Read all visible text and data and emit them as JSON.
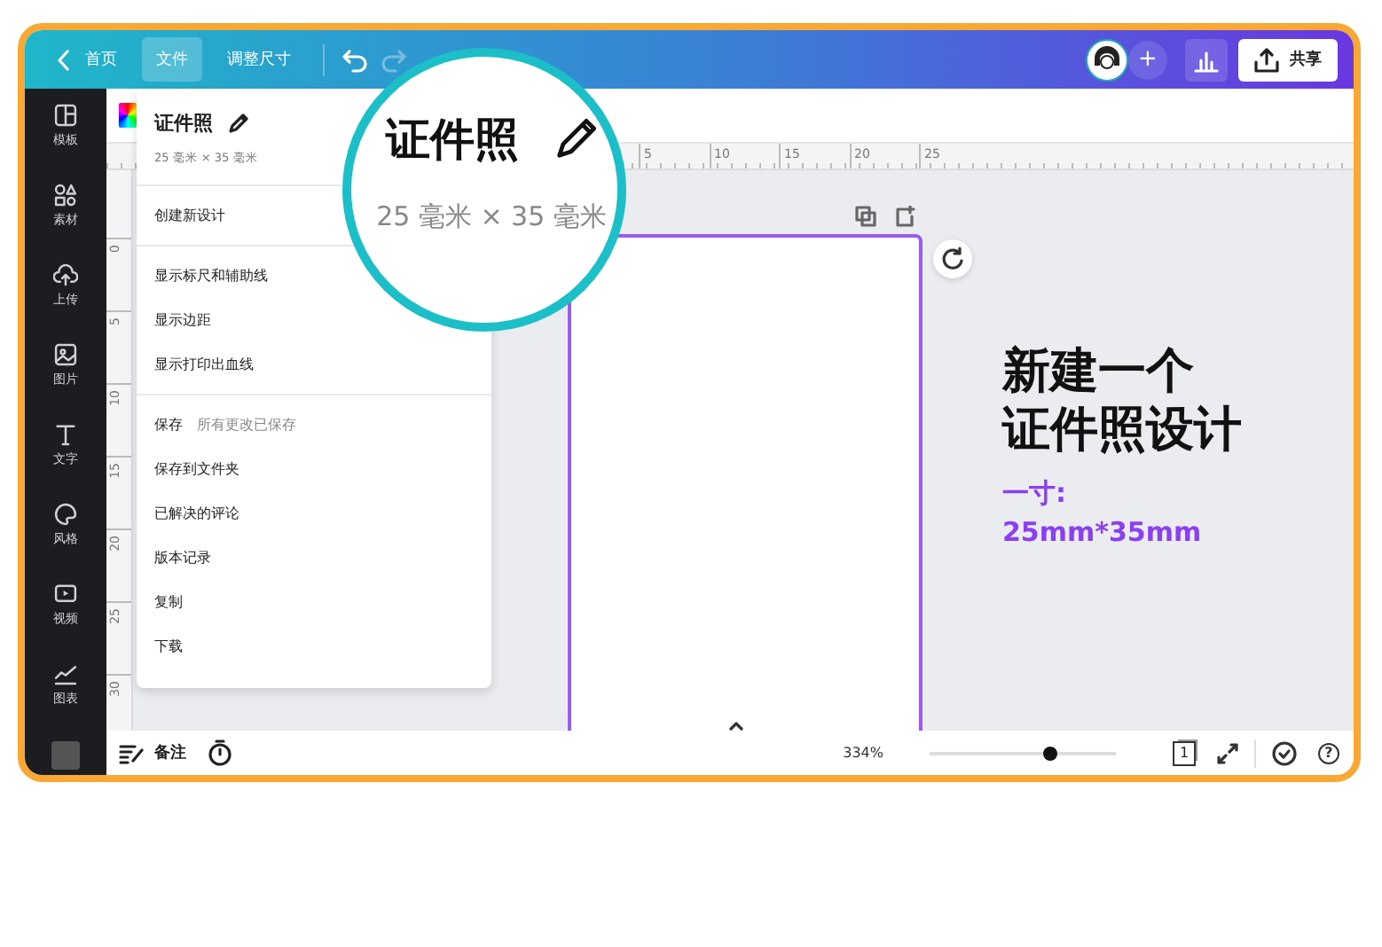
{
  "top_bar": {
    "back": {
      "label": "首页"
    },
    "tabs": [
      {
        "label": "文件",
        "selected": true
      },
      {
        "label": "调整尺寸",
        "selected": false
      }
    ],
    "history": [
      {
        "kind": "undo",
        "disabled": false
      },
      {
        "kind": "redo",
        "disabled": true
      }
    ],
    "add_label": "+",
    "share": {
      "label": "共享"
    }
  },
  "sidebar": {
    "items": [
      {
        "kind": "templates",
        "label": "模板"
      },
      {
        "kind": "elements",
        "label": "素材"
      },
      {
        "kind": "upload",
        "label": "上传"
      },
      {
        "kind": "photos",
        "label": "图片"
      },
      {
        "kind": "text",
        "label": "文字"
      },
      {
        "kind": "styles",
        "label": "风格"
      },
      {
        "kind": "video",
        "label": "视频"
      },
      {
        "kind": "charts",
        "label": "图表"
      },
      {
        "kind": "thumbnail"
      }
    ]
  },
  "ruler": {
    "horizontal": [
      "5",
      "10",
      "15",
      "20",
      "25"
    ],
    "vertical": [
      "0",
      "5",
      "10",
      "15",
      "20",
      "25",
      "30"
    ]
  },
  "file_menu": {
    "title": "证件照",
    "size": "25 毫米 × 35 毫米",
    "sections": [
      {
        "items": [
          {
            "label": "创建新设计"
          }
        ]
      },
      {
        "items": [
          {
            "label": "显示标尺和辅助线"
          },
          {
            "label": "显示边距"
          },
          {
            "label": "显示打印出血线"
          }
        ]
      },
      {
        "items": [
          {
            "label": "保存",
            "note": "所有更改已保存"
          },
          {
            "label": "保存到文件夹"
          },
          {
            "label": "已解决的评论"
          },
          {
            "label": "版本记录"
          },
          {
            "label": "复制"
          },
          {
            "label": "下载"
          }
        ]
      }
    ]
  },
  "magnifier": {
    "title": "证件照",
    "size": "25 毫米 × 35 毫米"
  },
  "annotation": {
    "heading": [
      "新建一个",
      "证件照设计"
    ],
    "subtitle": [
      "一寸:",
      "25mm*35mm"
    ]
  },
  "bottom_bar": {
    "notes": {
      "label": "备注"
    },
    "zoom": {
      "reading": "334%",
      "level": 0.65
    },
    "page_count": "1",
    "help": "?"
  }
}
